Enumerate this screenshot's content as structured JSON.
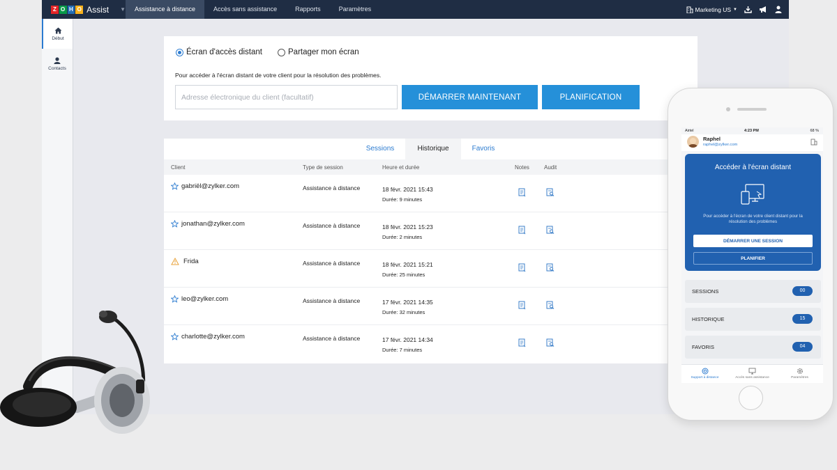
{
  "app": {
    "logo_letters": [
      "Z",
      "O",
      "H",
      "O"
    ],
    "logo_colors": [
      "#e42527",
      "#089949",
      "#226db4",
      "#f9b21d"
    ],
    "name": "Assist"
  },
  "topnav": {
    "items": [
      {
        "label": "Assistance à distance",
        "active": true
      },
      {
        "label": "Accès sans assistance",
        "active": false
      },
      {
        "label": "Rapports",
        "active": false
      },
      {
        "label": "Paramètres",
        "active": false
      }
    ],
    "org": "Marketing US"
  },
  "sidebar": {
    "items": [
      {
        "label": "Début",
        "icon": "home-icon",
        "active": true
      },
      {
        "label": "Contacts",
        "icon": "user-icon",
        "active": false
      }
    ]
  },
  "remote": {
    "option_remote": "Écran d'accès distant",
    "option_share": "Partager mon écran",
    "selected": "remote",
    "description": "Pour accéder à l'écran distant de votre client pour la résolution des problèmes.",
    "email_placeholder": "Adresse électronique du client (facultatif)",
    "start_label": "DÉMARRER MAINTENANT",
    "schedule_label": "PLANIFICATION"
  },
  "history": {
    "tabs": [
      "Sessions",
      "Historique",
      "Favoris"
    ],
    "active_tab": "Historique",
    "columns": {
      "client": "Client",
      "session_type": "Type de session",
      "time": "Heure et durée",
      "notes": "Notes",
      "audit": "Audit"
    },
    "rows": [
      {
        "client": "gabriël@zylker.com",
        "icon": "star-icon",
        "type": "Assistance à distance",
        "datetime": "18 févr. 2021 15:43",
        "duration": "Durée: 9 minutes"
      },
      {
        "client": "jonathan@zylker.com",
        "icon": "star-icon",
        "type": "Assistance à distance",
        "datetime": "18 févr. 2021 15:23",
        "duration": "Durée: 2 minutes"
      },
      {
        "client": "Frida",
        "icon": "warning-icon",
        "type": "Assistance à distance",
        "datetime": "18 févr. 2021 15:21",
        "duration": "Durée: 25 minutes"
      },
      {
        "client": "leo@zylker.com",
        "icon": "star-icon",
        "type": "Assistance à distance",
        "datetime": "17 févr. 2021 14:35",
        "duration": "Durée: 32 minutes"
      },
      {
        "client": "charlotte@zylker.com",
        "icon": "star-icon",
        "type": "Assistance à distance",
        "datetime": "17 févr. 2021 14:34",
        "duration": "Durée: 7 minutes"
      }
    ]
  },
  "phone": {
    "carrier": "Airtel",
    "time": "4:23 PM",
    "battery": "68 %",
    "user_name": "Raphel",
    "user_email": "raphel@zylker.com",
    "card_title": "Accéder à l'écran distant",
    "card_desc": "Pour accéder à l'écran de votre client distant pour la résolution des problèmes",
    "start_session": "DÉMARRER UNE SESSION",
    "plan": "PLANIFIER",
    "stats": [
      {
        "label": "SESSIONS",
        "count": "00"
      },
      {
        "label": "HISTORIQUE",
        "count": "15"
      },
      {
        "label": "FAVORIS",
        "count": "04"
      }
    ],
    "tabs": [
      {
        "label": "Support à distance",
        "icon": "lifebuoy-icon",
        "active": true
      },
      {
        "label": "Accès sans assistance",
        "icon": "monitor-icon",
        "active": false
      },
      {
        "label": "Paramètres",
        "icon": "gear-icon",
        "active": false
      }
    ]
  },
  "colors": {
    "topbar": "#1f2d44",
    "accent_blue": "#2590d9",
    "mobile_blue": "#2161b0"
  }
}
